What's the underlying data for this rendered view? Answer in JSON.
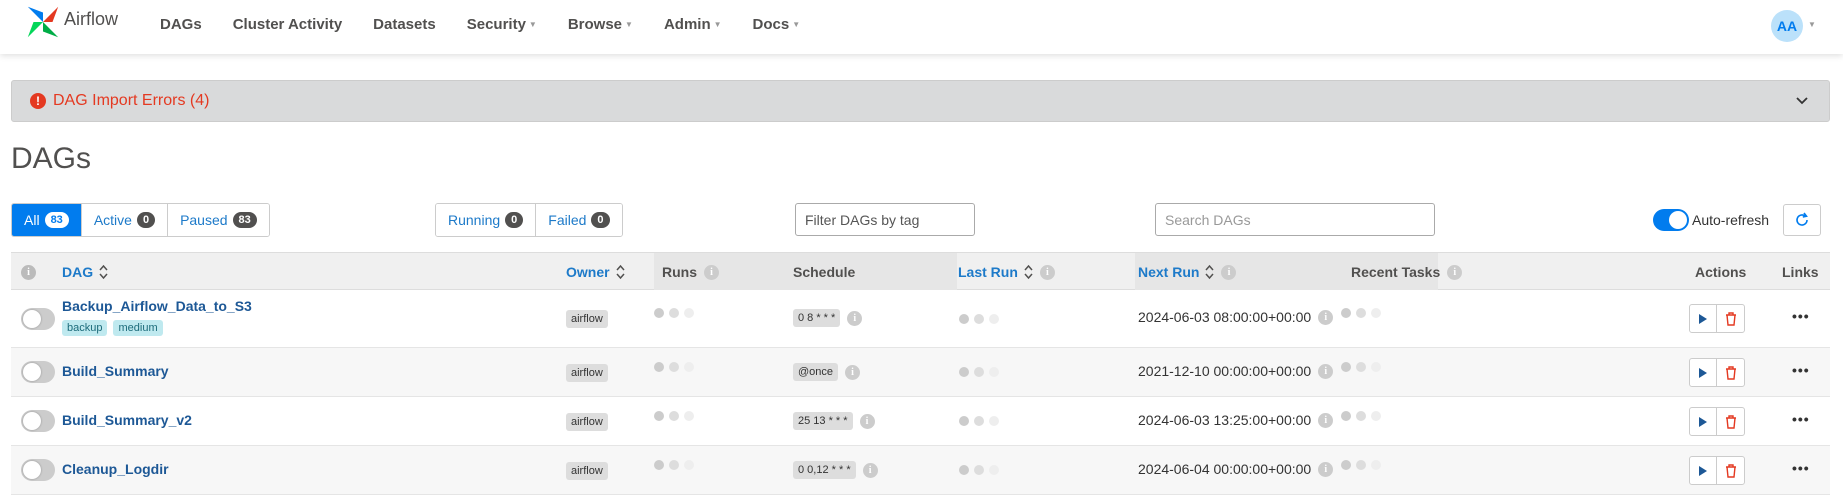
{
  "brand": {
    "name": "Airflow"
  },
  "nav": [
    {
      "label": "DAGs",
      "dropdown": false
    },
    {
      "label": "Cluster Activity",
      "dropdown": false
    },
    {
      "label": "Datasets",
      "dropdown": false
    },
    {
      "label": "Security",
      "dropdown": true
    },
    {
      "label": "Browse",
      "dropdown": true
    },
    {
      "label": "Admin",
      "dropdown": true
    },
    {
      "label": "Docs",
      "dropdown": true
    }
  ],
  "user": {
    "initials": "AA"
  },
  "import_errors": {
    "label": "DAG Import Errors (4)"
  },
  "page_title": "DAGs",
  "status_filters": {
    "all": {
      "label": "All",
      "count": "83"
    },
    "active": {
      "label": "Active",
      "count": "0"
    },
    "paused": {
      "label": "Paused",
      "count": "83"
    }
  },
  "run_filters": {
    "running": {
      "label": "Running",
      "count": "0"
    },
    "failed": {
      "label": "Failed",
      "count": "0"
    }
  },
  "tag_filter": {
    "placeholder": "Filter DAGs by tag"
  },
  "search": {
    "placeholder": "Search DAGs"
  },
  "auto_refresh": {
    "label": "Auto-refresh",
    "enabled": true
  },
  "columns": {
    "dag": "DAG",
    "owner": "Owner",
    "runs": "Runs",
    "schedule": "Schedule",
    "last_run": "Last Run",
    "next_run": "Next Run",
    "recent_tasks": "Recent Tasks",
    "actions": "Actions",
    "links": "Links"
  },
  "rows": [
    {
      "name": "Backup_Airflow_Data_to_S3",
      "tags": [
        "backup",
        "medium"
      ],
      "owner": "airflow",
      "schedule": "0 8 * * *",
      "next_run": "2024-06-03 08:00:00+00:00",
      "paused": true
    },
    {
      "name": "Build_Summary",
      "tags": [],
      "owner": "airflow",
      "schedule": "@once",
      "next_run": "2021-12-10 00:00:00+00:00",
      "paused": true
    },
    {
      "name": "Build_Summary_v2",
      "tags": [],
      "owner": "airflow",
      "schedule": "25 13 * * *",
      "next_run": "2024-06-03 13:25:00+00:00",
      "paused": true
    },
    {
      "name": "Cleanup_Logdir",
      "tags": [],
      "owner": "airflow",
      "schedule": "0 0,12 * * *",
      "next_run": "2024-06-04 00:00:00+00:00",
      "paused": true
    }
  ],
  "more_label": "•••",
  "colors": {
    "accent": "#017cee",
    "error": "#e43921",
    "link": "#1d5896",
    "tag_bg": "#bfe9ef",
    "delete": "#e43921"
  },
  "icons": [
    "airflow-logo",
    "error-icon",
    "chevron-down-icon",
    "sort-icon",
    "info-icon",
    "refresh-icon",
    "play-icon",
    "trash-icon",
    "more-icon"
  ]
}
